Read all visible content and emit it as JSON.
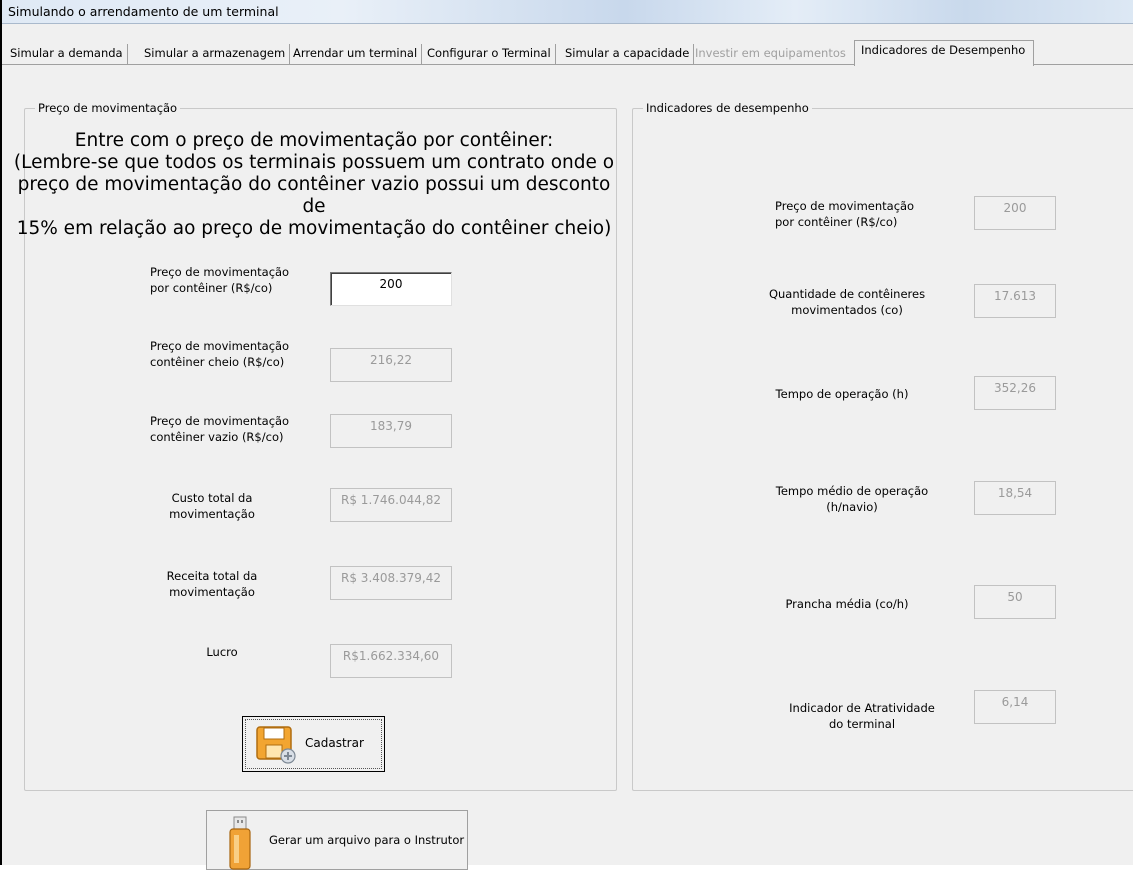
{
  "window": {
    "title": "Simulando o arrendamento de um terminal"
  },
  "tabs": [
    {
      "label": "Simular a demanda"
    },
    {
      "label": "Simular a armazenagem"
    },
    {
      "label": "Arrendar um terminal"
    },
    {
      "label": "Configurar o Terminal"
    },
    {
      "label": "Simular a capacidade"
    },
    {
      "label": "Investir em equipamentos"
    },
    {
      "label": "Indicadores de Desempenho"
    }
  ],
  "left_group": {
    "title": "Preço de movimentação",
    "instructions": [
      "Entre com o preço de movimentação por contêiner:",
      "(Lembre-se que todos os terminais possuem um contrato onde o",
      "preço de movimentação do contêiner vazio possui um desconto de",
      "15% em relação ao preço de movimentação do contêiner cheio)"
    ],
    "fields": [
      {
        "label_lines": [
          "Preço de movimentação",
          "por contêiner (R$/co)"
        ],
        "value": "200"
      },
      {
        "label_lines": [
          "Preço de movimentação",
          "contêiner cheio (R$/co)"
        ],
        "value": "216,22"
      },
      {
        "label_lines": [
          "Preço de movimentação",
          "contêiner vazio (R$/co)"
        ],
        "value": "183,79"
      },
      {
        "label_lines": [
          "Custo total da",
          "movimentação"
        ],
        "value": "R$ 1.746.044,82"
      },
      {
        "label_lines": [
          "Receita total da",
          "movimentação"
        ],
        "value": "R$ 3.408.379,42"
      },
      {
        "label_lines": [
          "Lucro"
        ],
        "value": "R$1.662.334,60"
      }
    ],
    "save_button": {
      "label": "Cadastrar",
      "icon": "save-icon"
    }
  },
  "right_group": {
    "title": "Indicadores de desempenho",
    "fields": [
      {
        "label_lines": [
          "Preço de movimentação",
          "por contêiner (R$/co)"
        ],
        "value": "200"
      },
      {
        "label_lines": [
          "Quantidade de contêineres",
          "movimentados (co)"
        ],
        "value": "17.613"
      },
      {
        "label_lines": [
          "Tempo de operação (h)"
        ],
        "value": "352,26"
      },
      {
        "label_lines": [
          "Tempo médio de operação",
          "(h/navio)"
        ],
        "value": "18,54"
      },
      {
        "label_lines": [
          "Prancha média (co/h)"
        ],
        "value": "50"
      },
      {
        "label_lines": [
          "Indicador de Atratividade",
          "do terminal"
        ],
        "value": "6,14"
      }
    ]
  },
  "export_button": {
    "label": "Gerar um arquivo para o Instrutor",
    "icon": "usb-drive-icon"
  },
  "colors": {
    "disabled_text": "#9a9a9a",
    "group_border": "#c9c9c9",
    "title_gradient": "#c8d8ec"
  }
}
